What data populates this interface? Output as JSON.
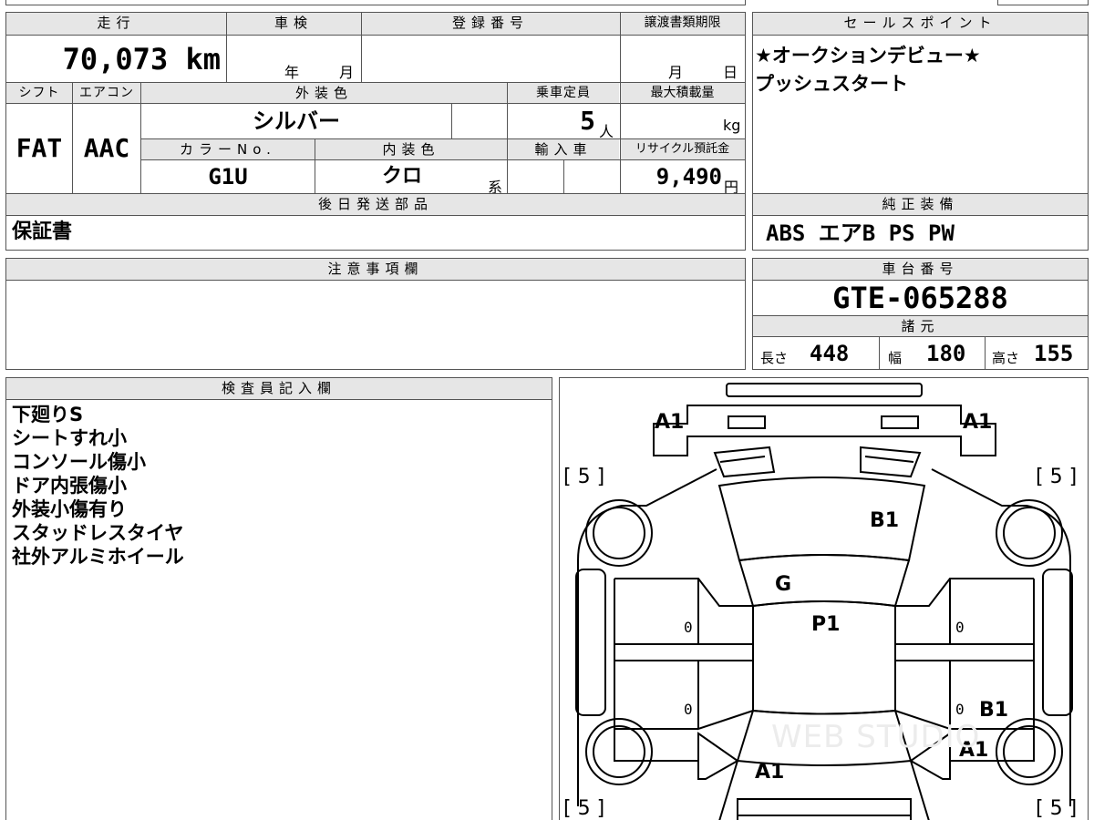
{
  "top_table": {
    "mileage_label": "走行",
    "mileage_value": "70,073",
    "mileage_unit": "km",
    "inspection_label": "車検",
    "inspection_year": "年",
    "inspection_month": "月",
    "registration_label": "登録番号",
    "transfer_label": "譲渡書類期限",
    "transfer_month": "月",
    "transfer_day": "日",
    "shift_label": "シフト",
    "shift_value": "FAT",
    "ac_label": "エアコン",
    "ac_value": "AAC",
    "exterior_label": "外装色",
    "exterior_value": "シルバー",
    "capacity_label": "乗車定員",
    "capacity_value": "5",
    "capacity_unit": "人",
    "max_load_label": "最大積載量",
    "max_load_unit": "kg",
    "color_no_label": "カラーNo.",
    "color_no_value": "G1U",
    "interior_label": "内装色",
    "interior_value": "クロ",
    "interior_suffix": "系",
    "import_label": "輸入車",
    "recycle_label": "リサイクル預託金",
    "recycle_value": "9,490",
    "recycle_unit": "円",
    "later_parts_label": "後日発送部品",
    "later_parts_value": "保証書"
  },
  "sales_point": {
    "label": "セールスポイント",
    "lines": [
      "★オークションデビュー★",
      "プッシュスタート"
    ]
  },
  "equipment": {
    "label": "純正装備",
    "value": "ABS エアB PS PW"
  },
  "notes": {
    "label": "注意事項欄"
  },
  "chassis": {
    "label": "車台番号",
    "value": "GTE-065288",
    "specs_label": "諸元",
    "length_label": "長さ",
    "length_value": "448",
    "width_label": "幅",
    "width_value": "180",
    "height_label": "高さ",
    "height_value": "155"
  },
  "inspector": {
    "label": "検査員記入欄",
    "lines": [
      "下廻りS",
      "シートすれ小",
      "コンソール傷小",
      "ドア内張傷小",
      "外装小傷有り",
      "スタッドレスタイヤ",
      "社外アルミホイール"
    ]
  },
  "diagram": {
    "front_left": "A1",
    "front_right": "A1",
    "tire_fl": "[ 5 ]",
    "tire_fr": "[ 5 ]",
    "tire_rl": "[ 5 ]",
    "tire_rr": "[ 5 ]",
    "hood": "B1",
    "windshield": "G",
    "roof": "P1",
    "door_l1": "0",
    "door_l2": "0",
    "door_r1": "0",
    "door_r2": "0",
    "rear_right_door": "B1",
    "rear_right_fender": "A1",
    "rear_center": "A1",
    "watermark": "WEB STUDIO"
  }
}
